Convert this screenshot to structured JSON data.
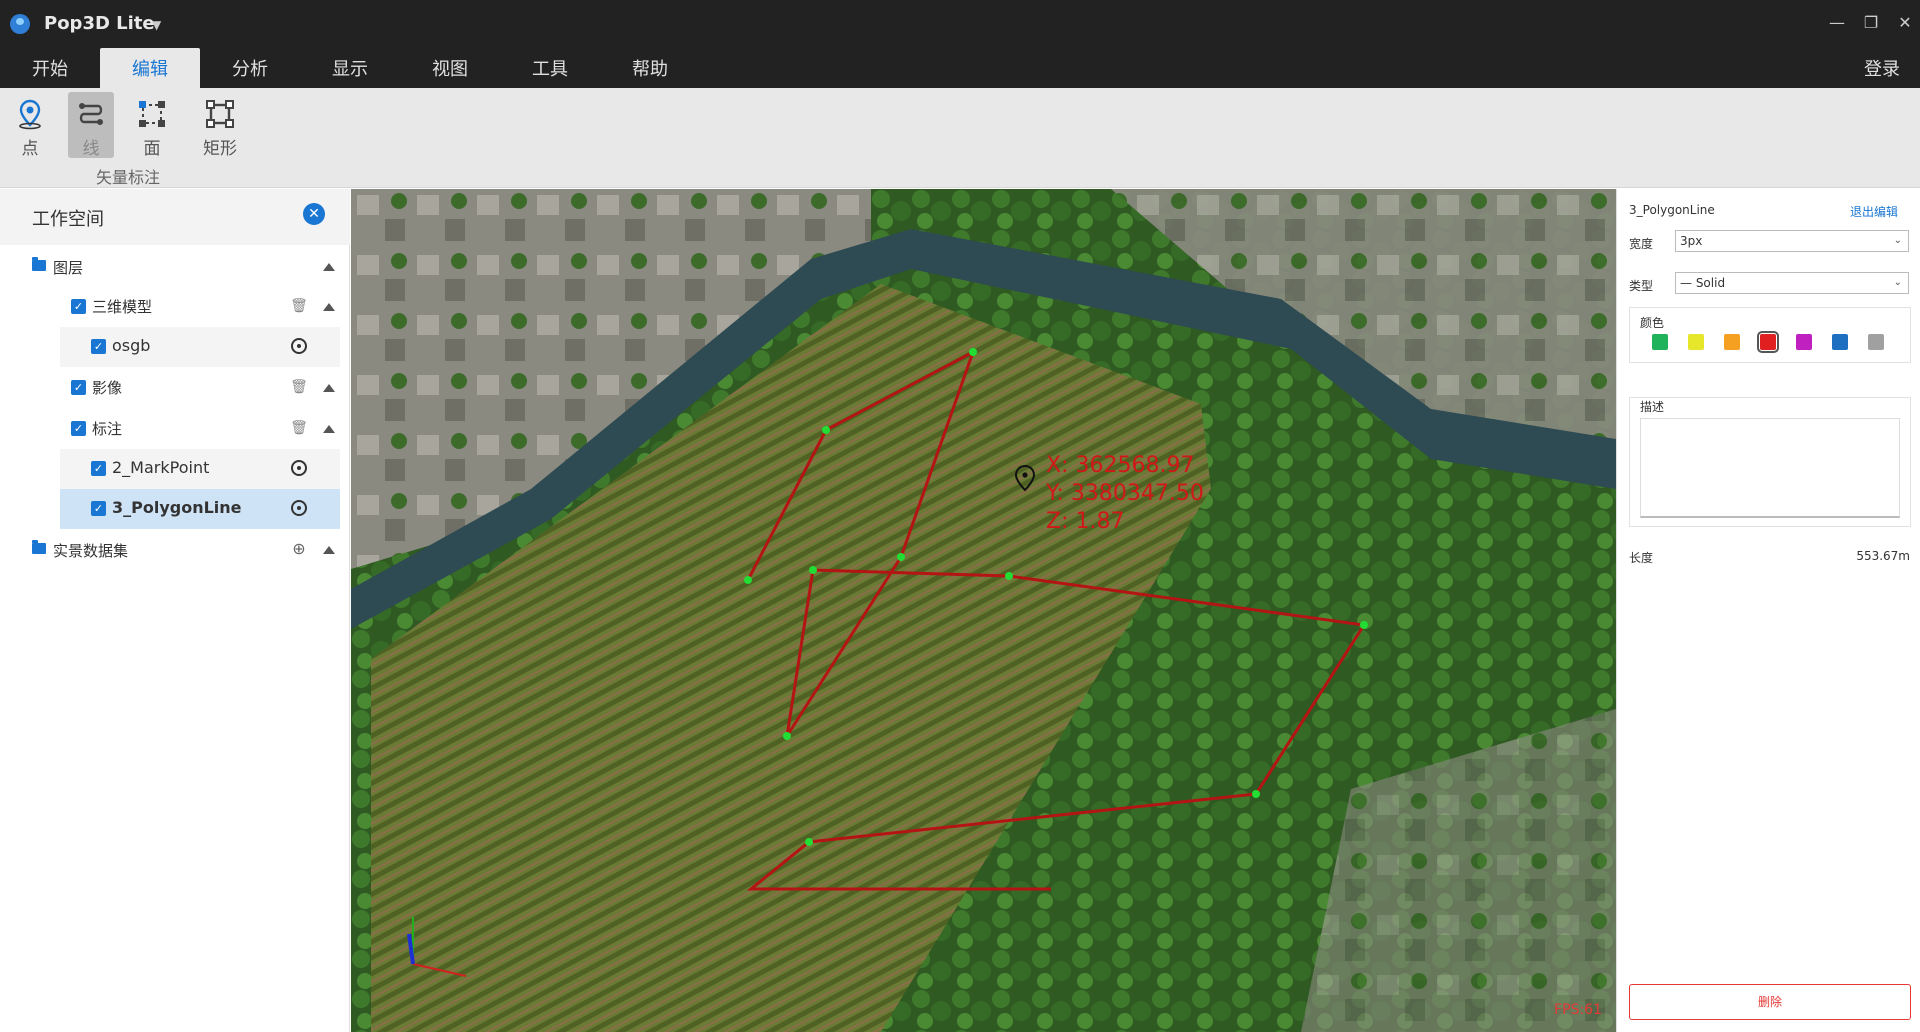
{
  "app": {
    "title": "Pop3D Lite"
  },
  "menu": {
    "tabs": [
      "开始",
      "编辑",
      "分析",
      "显示",
      "视图",
      "工具",
      "帮助"
    ],
    "active_index": 1,
    "login": "登录"
  },
  "ribbon": {
    "tools": [
      {
        "label": "点",
        "icon": "map-pin-icon"
      },
      {
        "label": "线",
        "icon": "polyline-icon"
      },
      {
        "label": "面",
        "icon": "polygon-icon"
      },
      {
        "label": "矩形",
        "icon": "rectangle-icon"
      }
    ],
    "active_tool": 1,
    "group_label": "矢量标注"
  },
  "workspace": {
    "title": "工作空间",
    "tree": {
      "layers": "图层",
      "model": "三维模型",
      "osgb": "osgb",
      "imagery": "影像",
      "annotation": "标注",
      "markpoint": "2_MarkPoint",
      "polyline": "3_PolygonLine",
      "dataset": "实景数据集"
    }
  },
  "viewport": {
    "coord_x": "X: 362568.97",
    "coord_y": "Y: 3380347.50",
    "coord_z": "Z: 1.87",
    "fps": "FPS:61"
  },
  "props": {
    "title": "3_PolygonLine",
    "exit": "退出编辑",
    "width_label": "宽度",
    "width_value": "3px",
    "type_label": "类型",
    "type_value": "— Solid",
    "color_label": "颜色",
    "colors": [
      "#21b35b",
      "#e6e62a",
      "#f5a020",
      "#e02020",
      "#c020c0",
      "#1e6fc0",
      "#a0a0a0"
    ],
    "selected_color": 3,
    "desc_label": "描述",
    "length_label": "长度",
    "length_value": "553.67m",
    "delete": "删除"
  }
}
